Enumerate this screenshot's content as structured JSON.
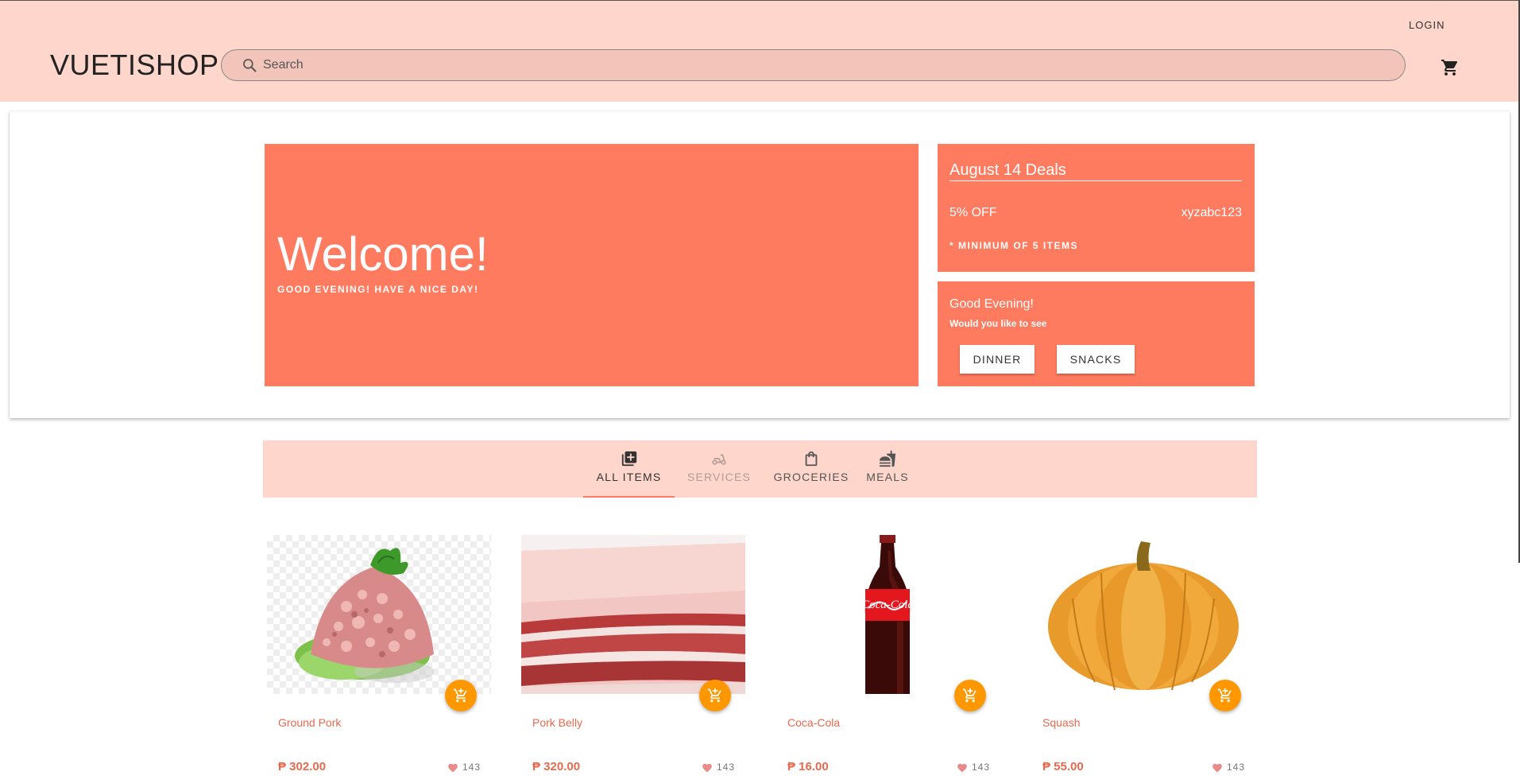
{
  "header": {
    "brand": "VUETISHOP",
    "search_placeholder": "Search",
    "login_label": "LOGIN",
    "cart_icon": "cart-icon"
  },
  "hero": {
    "welcome_title": "Welcome!",
    "welcome_subtitle": "GOOD EVENING! HAVE A NICE DAY!"
  },
  "deals": {
    "title": "August 14 Deals",
    "discount": "5% OFF",
    "code": "xyzabc123",
    "note": "* MINIMUM OF 5 ITEMS"
  },
  "greeting": {
    "title": "Good Evening!",
    "question": "Would you like to see",
    "buttons": [
      "DINNER",
      "SNACKS"
    ]
  },
  "tabs": [
    {
      "label": "ALL ITEMS",
      "icon": "library-add-icon",
      "active": true
    },
    {
      "label": "SERVICES",
      "icon": "moped-icon",
      "disabled": true
    },
    {
      "label": "GROCERIES",
      "icon": "shopping-bag-icon"
    },
    {
      "label": "MEALS",
      "icon": "fastfood-icon"
    }
  ],
  "products": [
    {
      "name": "Ground Pork",
      "price": "₱ 302.00",
      "likes": "143"
    },
    {
      "name": "Pork Belly",
      "price": "₱ 320.00",
      "likes": "143"
    },
    {
      "name": "Coca-Cola",
      "price": "₱ 16.00",
      "likes": "143"
    },
    {
      "name": "Squash",
      "price": "₱ 55.00",
      "likes": "143"
    }
  ],
  "colors": {
    "header_bg": "#ffd6cc",
    "accent": "#ff7b60",
    "fab": "#ff9800",
    "price": "#e8694d"
  }
}
